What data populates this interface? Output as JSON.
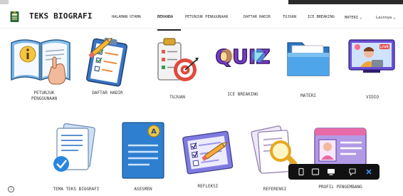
{
  "site": {
    "title": "TEKS BIOGRAFI"
  },
  "nav": {
    "items": [
      {
        "label": "HALAMAN UTAMA"
      },
      {
        "label": "BERANDA"
      },
      {
        "label": "PETUNJUK PENGGUNAAN"
      },
      {
        "label": "DAFTAR HADIR"
      },
      {
        "label": "TUJUAN"
      },
      {
        "label": "ICE BREAKING"
      },
      {
        "label": "MATERI"
      },
      {
        "label": "Lainnya"
      }
    ]
  },
  "cards": {
    "petunjuk": {
      "label1": "PETUNJUK",
      "label2": "PENGGUNAAN"
    },
    "daftar_hadir": {
      "label": "DAFTAR HADIR"
    },
    "tujuan": {
      "label": "TUJUAN"
    },
    "ice_breaking": {
      "label": "ICE BREAKING",
      "quiz_text": "QUIZ"
    },
    "materi": {
      "label": "MATERI"
    },
    "video": {
      "label": "VIDIO",
      "live_badge": "LIVE"
    },
    "tema": {
      "label": "TEMA TEKS BIOGRAFI"
    },
    "asesmen": {
      "label": "ASESMEN",
      "badge": "A"
    },
    "refleksi": {
      "label": "REFLEKSI"
    },
    "referensi": {
      "label": "REFERENSI"
    },
    "profil": {
      "label": "PROFIL PENGEMBANG"
    }
  },
  "info_button": {
    "label": "i"
  },
  "colors": {
    "active_underline": "#1f1f1f",
    "toolbar_bg": "#111111",
    "close_accent": "#3b8ff0"
  },
  "icons": [
    "grid-icon",
    "tablet-icon",
    "desktop-icon",
    "comment-icon",
    "close-icon",
    "chevron-down-icon",
    "info-icon"
  ]
}
